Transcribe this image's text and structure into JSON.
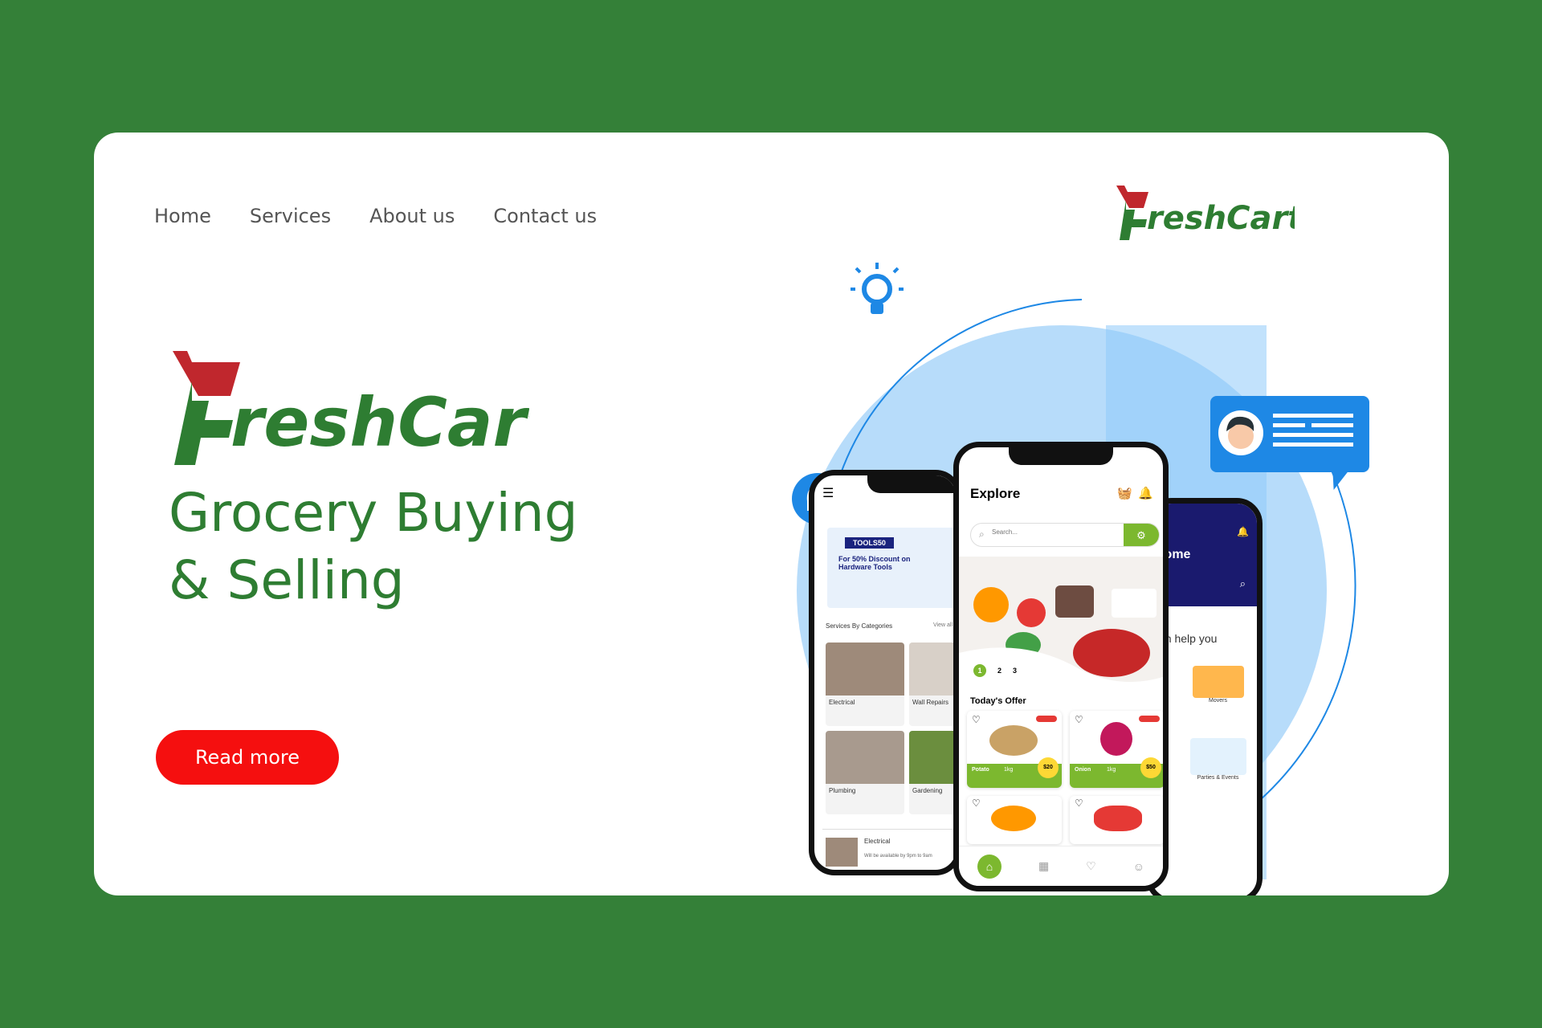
{
  "nav": {
    "items": [
      {
        "label": "Home"
      },
      {
        "label": "Services"
      },
      {
        "label": "About us"
      },
      {
        "label": "Contact us"
      }
    ]
  },
  "brand": {
    "name_suffix": "reshCart",
    "color": "#2e7d32",
    "cart_color": "#c0272d"
  },
  "hero": {
    "line1": "Grocery Buying",
    "line2": "& Selling",
    "cta_label": "Read more",
    "cta_color": "#f50f0f"
  },
  "phones": {
    "left": {
      "promo_code": "TOOLS50",
      "promo_text": "For 50% Discount on Hardware Tools",
      "section_title": "Services By Categories",
      "view_all": "View all",
      "categories": [
        "Electrical",
        "Wall Repairs",
        "Plumbing",
        "Gardening"
      ],
      "bottom_item": "Electrical",
      "bottom_note": "Will be available by 9pm to 9am"
    },
    "middle": {
      "title": "Explore",
      "search_placeholder": "Search...",
      "pager": [
        "1",
        "2",
        "3"
      ],
      "offer_title": "Today's Offer",
      "products": [
        {
          "name": "Potato",
          "weight": "1kg",
          "price": "$20"
        },
        {
          "name": "Onion",
          "weight": "1kg",
          "price": "$50"
        }
      ]
    },
    "right": {
      "title": "Home",
      "tagline": "can help you",
      "items": [
        "Movers",
        "Parties & Events"
      ]
    }
  }
}
